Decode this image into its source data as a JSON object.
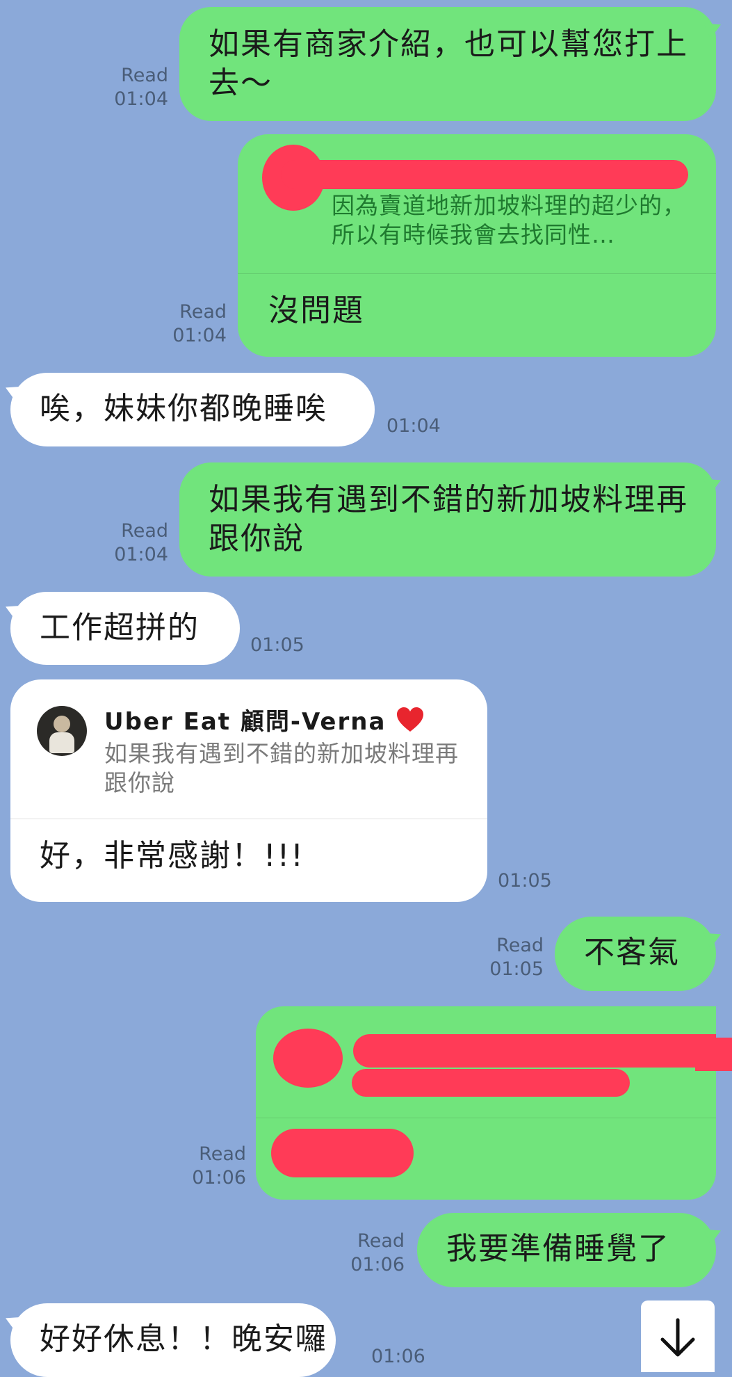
{
  "messages": {
    "m1": {
      "text": "如果有商家介紹，也可以幫您打上去～",
      "read": "Read",
      "time": "01:04"
    },
    "m2": {
      "quote_text": "因為賣道地新加坡料理的超少的，所以有時候我會去找同性…",
      "text": "沒問題",
      "read": "Read",
      "time": "01:04"
    },
    "m3": {
      "text": "唉，妹妹你都晚睡唉",
      "time": "01:04"
    },
    "m4": {
      "text": "如果我有遇到不錯的新加坡料理再跟你說",
      "read": "Read",
      "time": "01:04"
    },
    "m5": {
      "text": "工作超拼的",
      "time": "01:05"
    },
    "m6": {
      "quote_author": "Uber Eat 顧問-Verna",
      "quote_text": "如果我有遇到不錯的新加坡料理再跟你說",
      "text": "好，非常感謝！!!!",
      "time": "01:05"
    },
    "m7": {
      "text": "不客氣",
      "read": "Read",
      "time": "01:05"
    },
    "m8": {
      "read": "Read",
      "time": "01:06"
    },
    "m9": {
      "text": "我要準備睡覺了",
      "read": "Read",
      "time": "01:06"
    },
    "m10": {
      "text": "好好休息！！晚安囉",
      "time": "01:06"
    }
  },
  "colors": {
    "background": "#8ba9d9",
    "sent_bubble": "#71e47c",
    "received_bubble": "#ffffff",
    "redaction": "#ff3b57"
  },
  "icons": {
    "scroll_down": "arrow-down-icon",
    "heart": "red-heart-icon"
  }
}
